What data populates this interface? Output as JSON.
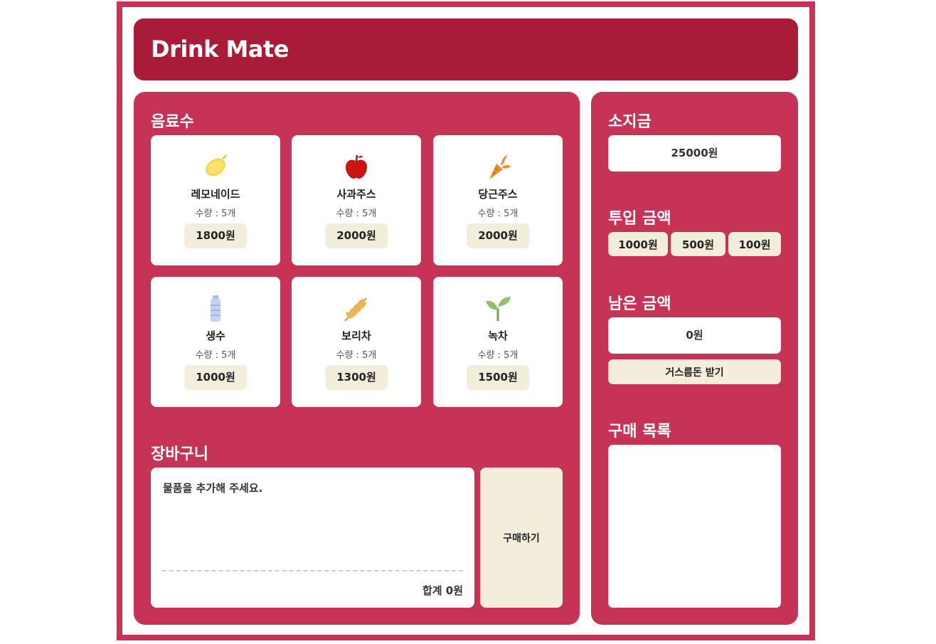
{
  "header": {
    "title": "Drink Mate"
  },
  "drinks_section": {
    "title": "음료수"
  },
  "drinks": [
    {
      "name": "레모네이드",
      "qty": "수량 : 5개",
      "price": "1800원",
      "icon": "lemon-icon"
    },
    {
      "name": "사과주스",
      "qty": "수량 : 5개",
      "price": "2000원",
      "icon": "apple-icon"
    },
    {
      "name": "당근주스",
      "qty": "수량 : 5개",
      "price": "2000원",
      "icon": "carrot-icon"
    },
    {
      "name": "생수",
      "qty": "수량 : 5개",
      "price": "1000원",
      "icon": "water-bottle-icon"
    },
    {
      "name": "보리차",
      "qty": "수량 : 5개",
      "price": "1300원",
      "icon": "barley-icon"
    },
    {
      "name": "녹차",
      "qty": "수량 : 5개",
      "price": "1500원",
      "icon": "sprout-icon"
    }
  ],
  "cart": {
    "title": "장바구니",
    "empty_message": "물품을 추가해 주세요.",
    "total": "합계 0원",
    "buy_label": "구매하기"
  },
  "wallet": {
    "title": "소지금",
    "amount": "25000원"
  },
  "insert": {
    "title": "투입 금액",
    "coins": [
      "1000원",
      "500원",
      "100원"
    ]
  },
  "remaining": {
    "title": "남은 금액",
    "amount": "0원",
    "change_label": "거스름돈 받기"
  },
  "purchases": {
    "title": "구매 목록"
  },
  "colors": {
    "frame": "#c73355",
    "header": "#a91c38",
    "button_bg": "#f3eddb"
  }
}
